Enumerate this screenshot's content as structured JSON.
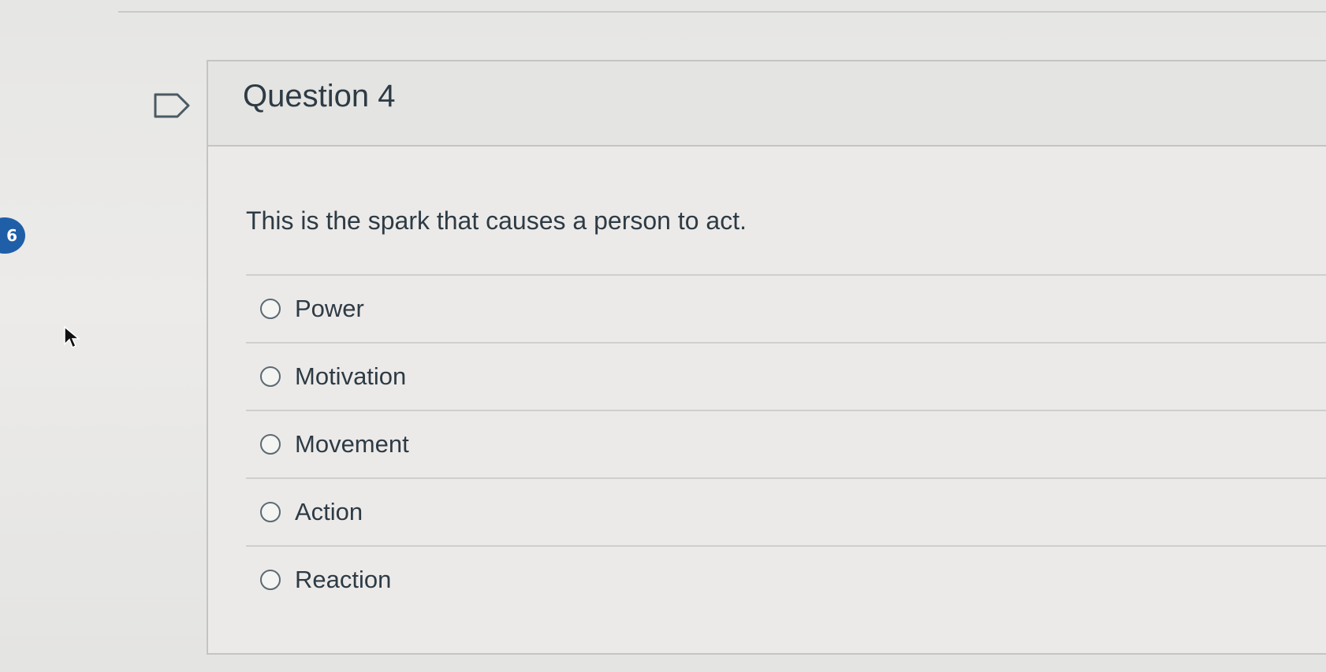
{
  "quiz_nav": {
    "badge_text": "6"
  },
  "question": {
    "title": "Question 4",
    "text": "This is the spark that causes a person to act.",
    "answers": [
      {
        "label": "Power"
      },
      {
        "label": "Motivation"
      },
      {
        "label": "Movement"
      },
      {
        "label": "Action"
      },
      {
        "label": "Reaction"
      }
    ]
  },
  "icons": {
    "flag": "flag-question-icon",
    "cursor": "mouse-pointer-icon"
  },
  "colors": {
    "badge": "#1f5fa8",
    "text": "#2d3b45",
    "border": "#c4c4c2"
  }
}
